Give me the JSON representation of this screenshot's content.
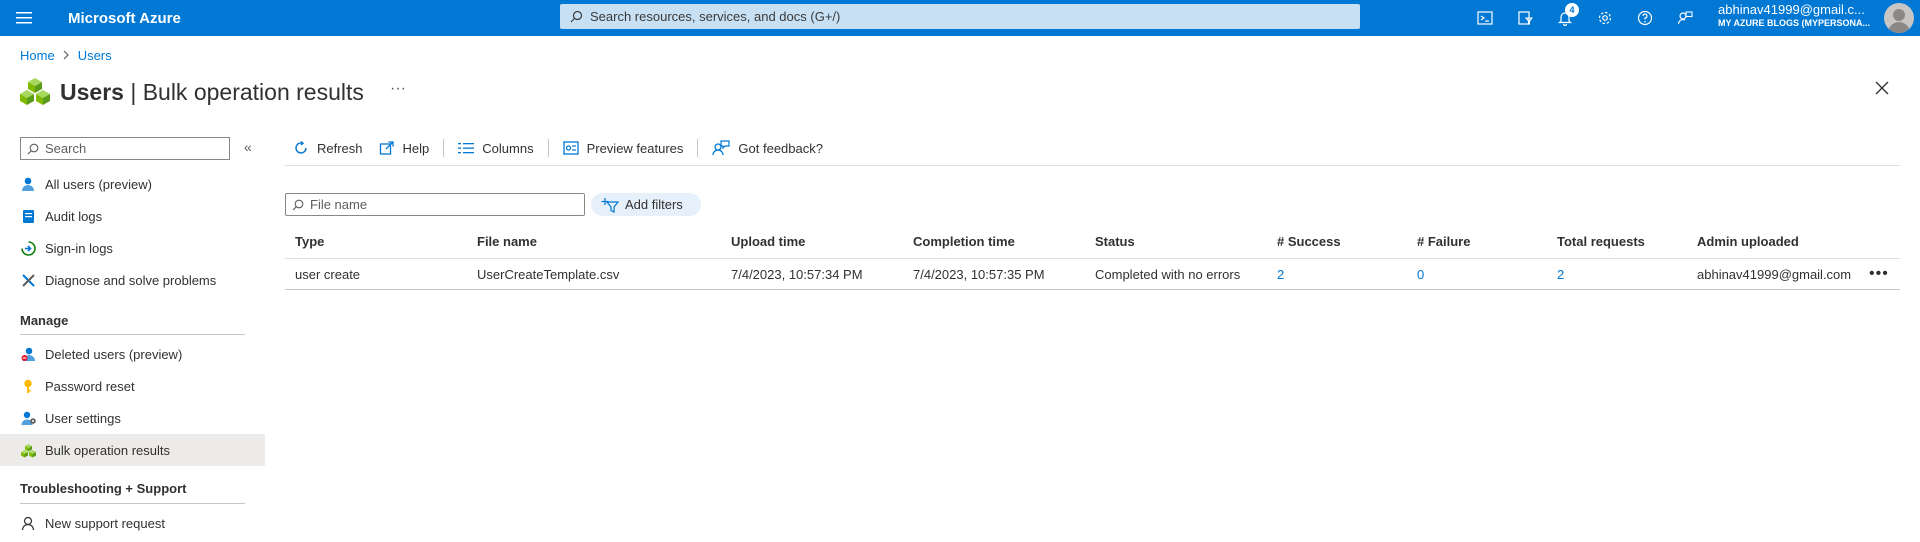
{
  "topbar": {
    "brand": "Microsoft Azure",
    "search_placeholder": "Search resources, services, and docs (G+/)",
    "notification_count": "4",
    "account_email": "abhinav41999@gmail.c...",
    "account_directory": "MY AZURE BLOGS (MYPERSONA..."
  },
  "breadcrumb": {
    "home": "Home",
    "users": "Users"
  },
  "header": {
    "title_bold": "Users",
    "title_rest": " | Bulk operation results",
    "more": "···"
  },
  "sidebar": {
    "search_placeholder": "Search",
    "collapse": "«",
    "items": [
      {
        "label": "All users (preview)"
      },
      {
        "label": "Audit logs"
      },
      {
        "label": "Sign-in logs"
      },
      {
        "label": "Diagnose and solve problems"
      }
    ],
    "manage_heading": "Manage",
    "manage_items": [
      {
        "label": "Deleted users (preview)"
      },
      {
        "label": "Password reset"
      },
      {
        "label": "User settings"
      },
      {
        "label": "Bulk operation results"
      }
    ],
    "support_heading": "Troubleshooting + Support",
    "support_items": [
      {
        "label": "New support request"
      }
    ]
  },
  "toolbar": {
    "refresh": "Refresh",
    "help": "Help",
    "columns": "Columns",
    "preview": "Preview features",
    "feedback": "Got feedback?"
  },
  "filters": {
    "file_placeholder": "File name",
    "add_filters": "Add filters"
  },
  "table": {
    "headers": [
      "Type",
      "File name",
      "Upload time",
      "Completion time",
      "Status",
      "# Success",
      "# Failure",
      "Total requests",
      "Admin uploaded"
    ],
    "rows": [
      {
        "type": "user create",
        "file_name": "UserCreateTemplate.csv",
        "upload_time": "7/4/2023, 10:57:34 PM",
        "completion_time": "7/4/2023, 10:57:35 PM",
        "status": "Completed with no errors",
        "success": "2",
        "failure": "0",
        "total": "2",
        "admin": "abhinav41999@gmail.com",
        "more": "•••"
      }
    ]
  },
  "colors": {
    "accent": "#0078d4",
    "topbar_search": "#c7e0f4",
    "active_nav": "#edebe9"
  }
}
